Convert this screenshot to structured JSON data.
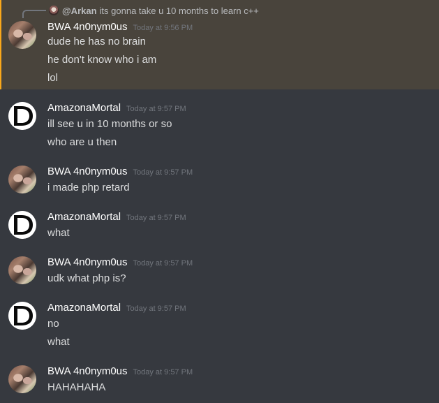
{
  "reply": {
    "name": "@Arkan",
    "text": "its gonna take u 10 months to learn c++"
  },
  "groups": [
    {
      "author": "BWA 4n0nym0us",
      "time": "Today at 9:56 PM",
      "messages": [
        "dude he has no brain",
        "he don't know who i am",
        "lol"
      ]
    },
    {
      "author": "AmazonaMortal",
      "time": "Today at 9:57 PM",
      "messages": [
        "ill see u in 10 months or so",
        "who are u then"
      ]
    },
    {
      "author": "BWA 4n0nym0us",
      "time": "Today at 9:57 PM",
      "messages": [
        "i made php retard"
      ]
    },
    {
      "author": "AmazonaMortal",
      "time": "Today at 9:57 PM",
      "messages": [
        "what"
      ]
    },
    {
      "author": "BWA 4n0nym0us",
      "time": "Today at 9:57 PM",
      "messages": [
        "udk what php is?"
      ]
    },
    {
      "author": "AmazonaMortal",
      "time": "Today at 9:57 PM",
      "messages": [
        "no",
        "what"
      ]
    },
    {
      "author": "BWA 4n0nym0us",
      "time": "Today at 9:57 PM",
      "messages": [
        "HAHAHAHA"
      ]
    }
  ],
  "colors": {
    "background": "#36393f",
    "highlight": "#49443c",
    "username": "#ffffff",
    "timestamp": "#72767d",
    "message_text": "#dcddde"
  },
  "icons": {
    "bwa_avatar": "user-photo-avatar",
    "am_avatar": "d-logo-avatar"
  }
}
